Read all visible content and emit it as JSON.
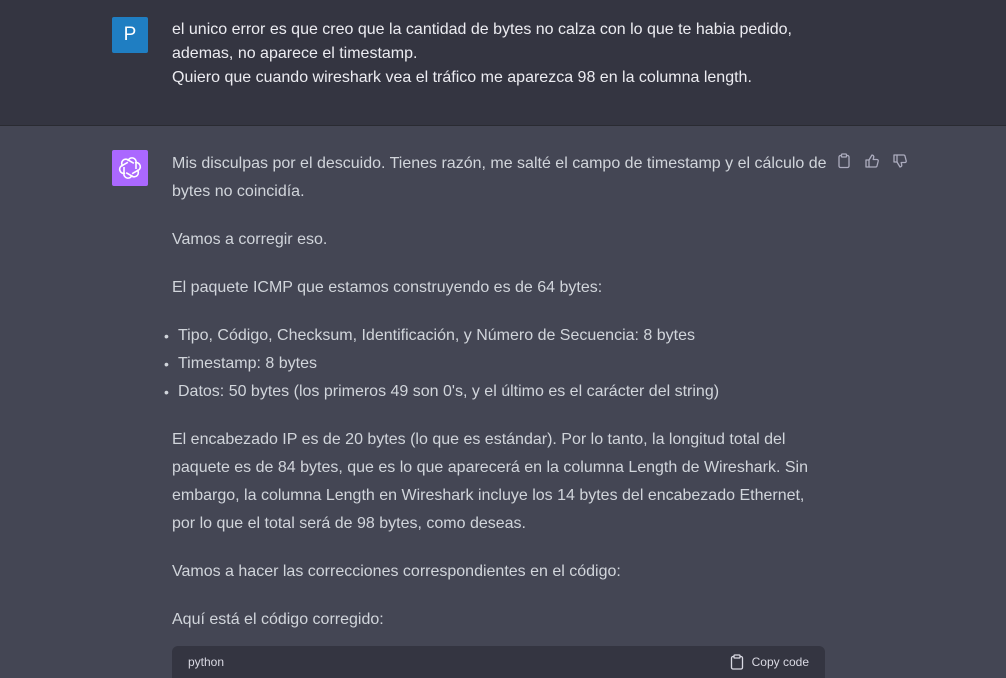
{
  "user_message": {
    "avatar_letter": "P",
    "lines": [
      "el unico error es que creo que la cantidad de bytes no calza con lo que te habia pedido,",
      "ademas, no aparece el timestamp.",
      "Quiero que cuando wireshark vea el tráfico me aparezca 98 en la columna length."
    ]
  },
  "assistant_message": {
    "paragraphs": [
      "Mis disculpas por el descuido. Tienes razón, me salté el campo de timestamp y el cálculo de bytes no coincidía.",
      "Vamos a corregir eso.",
      "El paquete ICMP que estamos construyendo es de 64 bytes:"
    ],
    "bullets": [
      "Tipo, Código, Checksum, Identificación, y Número de Secuencia: 8 bytes",
      "Timestamp: 8 bytes",
      "Datos: 50 bytes (los primeros 49 son 0's, y el último es el carácter del string)"
    ],
    "paragraphs_after": [
      "El encabezado IP es de 20 bytes (lo que es estándar). Por lo tanto, la longitud total del paquete es de 84 bytes, que es lo que aparecerá en la columna Length de Wireshark. Sin embargo, la columna Length en Wireshark incluye los 14 bytes del encabezado Ethernet, por lo que el total será de 98 bytes, como deseas.",
      "Vamos a hacer las correcciones correspondientes en el código:",
      "Aquí está el código corregido:"
    ],
    "code_block": {
      "language": "python",
      "copy_label": "Copy code"
    },
    "action_icons": [
      "clipboard-icon",
      "thumbs-up-icon",
      "thumbs-down-icon"
    ]
  },
  "colors": {
    "user_bg": "#343541",
    "assistant_bg": "#444654",
    "user_avatar": "#1f7ec2",
    "bot_avatar": "#ab68ff"
  }
}
